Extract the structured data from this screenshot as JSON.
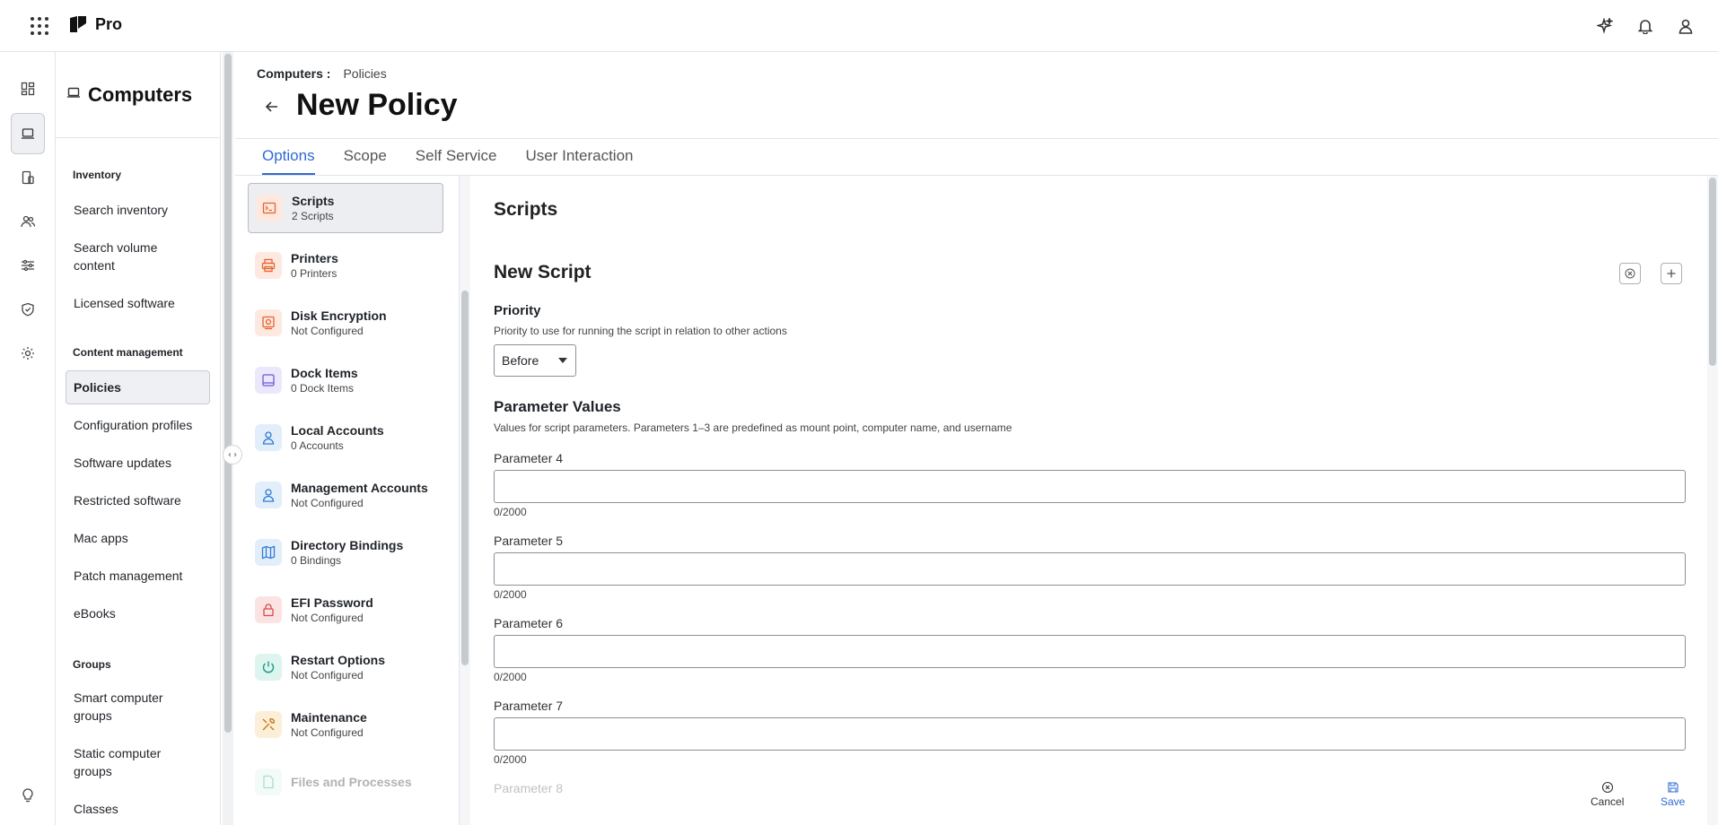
{
  "app": {
    "name": "Pro"
  },
  "topbar": {
    "icons": [
      "apps-grid-icon",
      "sparkle-icon",
      "bell-icon",
      "user-icon"
    ]
  },
  "rail": {
    "icons": [
      "dashboard-icon",
      "computer-icon",
      "devices-icon",
      "users-icon",
      "settings-sliders-icon",
      "shield-icon",
      "gear-icon",
      "lightbulb-icon"
    ]
  },
  "sidebar": {
    "title": "Computers",
    "sections": [
      {
        "label": "Inventory",
        "items": [
          "Search inventory",
          "Search volume content",
          "Licensed software"
        ]
      },
      {
        "label": "Content management",
        "items": [
          "Policies",
          "Configuration profiles",
          "Software updates",
          "Restricted software",
          "Mac apps",
          "Patch management",
          "eBooks"
        ]
      },
      {
        "label": "Groups",
        "items": [
          "Smart computer groups",
          "Static computer groups",
          "Classes"
        ]
      }
    ],
    "active_item": "Policies"
  },
  "breadcrumb": {
    "parent": "Computers",
    "separator": ":",
    "current": "Policies"
  },
  "page": {
    "title": "New Policy"
  },
  "tabs": [
    "Options",
    "Scope",
    "Self Service",
    "User Interaction"
  ],
  "active_tab": "Options",
  "options": [
    {
      "title": "Scripts",
      "subtitle": "2 Scripts",
      "icon": "terminal-icon",
      "color": "#e8622c",
      "bg": "#fde9df"
    },
    {
      "title": "Printers",
      "subtitle": "0 Printers",
      "icon": "printer-icon",
      "color": "#e8622c",
      "bg": "#fde9df"
    },
    {
      "title": "Disk Encryption",
      "subtitle": "Not Configured",
      "icon": "disk-encryption-icon",
      "color": "#e8622c",
      "bg": "#fde9df"
    },
    {
      "title": "Dock Items",
      "subtitle": "0 Dock Items",
      "icon": "dock-icon",
      "color": "#6b5bd6",
      "bg": "#ebe8fb"
    },
    {
      "title": "Local Accounts",
      "subtitle": "0 Accounts",
      "icon": "account-icon",
      "color": "#2e7bd6",
      "bg": "#e3eefb"
    },
    {
      "title": "Management Accounts",
      "subtitle": "Not Configured",
      "icon": "management-account-icon",
      "color": "#2e7bd6",
      "bg": "#e3eefb"
    },
    {
      "title": "Directory Bindings",
      "subtitle": "0 Bindings",
      "icon": "map-icon",
      "color": "#2e7bd6",
      "bg": "#e3eefb"
    },
    {
      "title": "EFI Password",
      "subtitle": "Not Configured",
      "icon": "lock-icon",
      "color": "#d84a4a",
      "bg": "#fbe3e3"
    },
    {
      "title": "Restart Options",
      "subtitle": "Not Configured",
      "icon": "power-icon",
      "color": "#1a9e84",
      "bg": "#ddf4ef"
    },
    {
      "title": "Maintenance",
      "subtitle": "Not Configured",
      "icon": "tools-icon",
      "color": "#c77a12",
      "bg": "#fcefd9"
    },
    {
      "title": "Files and Processes",
      "subtitle": "",
      "icon": "file-icon",
      "color": "#1a9e84",
      "bg": "#ddf4ef"
    }
  ],
  "form": {
    "section_title": "Scripts",
    "script_title": "New Script",
    "priority": {
      "label": "Priority",
      "help": "Priority to use for running the script in relation to other actions",
      "value": "Before"
    },
    "params": {
      "title": "Parameter Values",
      "help": "Values for script parameters. Parameters 1–3 are predefined as mount point, computer name, and username",
      "fields": [
        {
          "label": "Parameter 4",
          "value": "",
          "counter": "0/2000"
        },
        {
          "label": "Parameter 5",
          "value": "",
          "counter": "0/2000"
        },
        {
          "label": "Parameter 6",
          "value": "",
          "counter": "0/2000"
        },
        {
          "label": "Parameter 7",
          "value": "",
          "counter": "0/2000"
        }
      ],
      "partial_label": "Parameter 8"
    }
  },
  "actions": {
    "cancel": "Cancel",
    "save": "Save"
  },
  "colors": {
    "accent": "#2e6ad6"
  }
}
